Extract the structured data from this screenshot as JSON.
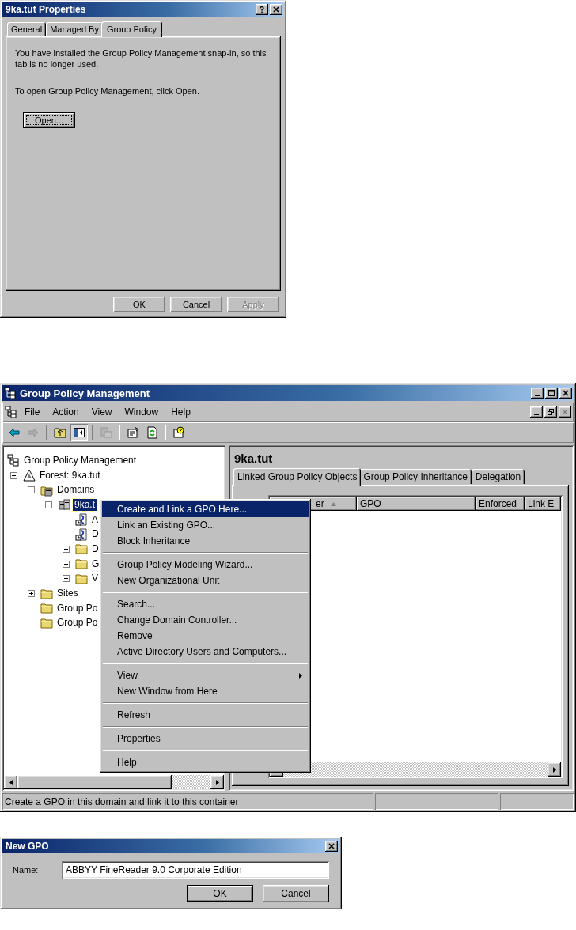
{
  "properties_dialog": {
    "title": "9ka.tut Properties",
    "tabs": [
      {
        "label": "General",
        "selected": false
      },
      {
        "label": "Managed By",
        "selected": false
      },
      {
        "label": "Group Policy",
        "selected": true
      }
    ],
    "paragraphs": [
      "You have installed the Group Policy Management snap-in, so this tab is no longer used.",
      "To open Group Policy Management, click Open."
    ],
    "open_button": {
      "label": "Open...",
      "focused": true
    },
    "buttons": [
      {
        "label": "OK",
        "disabled": false
      },
      {
        "label": "Cancel",
        "disabled": false
      },
      {
        "label": "Apply",
        "disabled": true
      }
    ]
  },
  "gpmc_window": {
    "title": "Group Policy Management",
    "menu_bar": [
      "File",
      "Action",
      "View",
      "Window",
      "Help"
    ],
    "toolbar": [
      {
        "kind": "back",
        "disabled": false,
        "pressed": false
      },
      {
        "kind": "forward",
        "disabled": true,
        "pressed": false
      },
      {
        "kind": "up",
        "disabled": false,
        "pressed": false
      },
      {
        "kind": "tree",
        "disabled": false,
        "pressed": true
      },
      {
        "kind": "export",
        "disabled": true,
        "pressed": false
      },
      {
        "kind": "properties",
        "disabled": false,
        "pressed": false
      },
      {
        "kind": "refresh",
        "disabled": false,
        "pressed": false
      },
      {
        "kind": "help",
        "disabled": false,
        "pressed": false
      }
    ],
    "tree": [
      {
        "label": "Group Policy Management",
        "kind": "console",
        "selected": false,
        "children": [
          {
            "label": "Forest: 9ka.tut",
            "kind": "forest",
            "selected": false,
            "expanded": true,
            "children": [
              {
                "label": "Domains",
                "kind": "domains",
                "selected": false,
                "expanded": true,
                "children": [
                  {
                    "label": "9ka.t",
                    "kind": "domain",
                    "selected": true,
                    "expanded": true,
                    "children": [
                      {
                        "label": "A",
                        "kind": "link",
                        "selected": false
                      },
                      {
                        "label": "D",
                        "kind": "link",
                        "selected": false
                      },
                      {
                        "label": "D",
                        "kind": "folder",
                        "selected": false,
                        "expanded": false
                      },
                      {
                        "label": "G",
                        "kind": "folder",
                        "selected": false,
                        "expanded": false
                      },
                      {
                        "label": "V",
                        "kind": "folder",
                        "selected": false,
                        "expanded": false
                      }
                    ]
                  }
                ]
              },
              {
                "label": "Sites",
                "kind": "folder",
                "selected": false,
                "expanded": false
              },
              {
                "label": "Group Po",
                "kind": "folder",
                "selected": false
              },
              {
                "label": "Group Po",
                "kind": "folder",
                "selected": false
              }
            ]
          }
        ]
      }
    ],
    "details": {
      "title": "9ka.tut",
      "tabs": [
        {
          "label": "Linked Group Policy Objects",
          "selected": true
        },
        {
          "label": "Group Policy Inheritance",
          "selected": false
        },
        {
          "label": "Delegation",
          "selected": false
        }
      ],
      "columns": [
        {
          "label": "er",
          "sorted": true
        },
        {
          "label": "GPO",
          "sorted": false
        },
        {
          "label": "Enforced",
          "sorted": false
        },
        {
          "label": "Link E",
          "sorted": false
        }
      ]
    },
    "context_menu": {
      "groups": [
        [
          {
            "label": "Create and Link a GPO Here...",
            "selected": true,
            "submenu": false
          },
          {
            "label": "Link an Existing GPO...",
            "selected": false,
            "submenu": false
          },
          {
            "label": "Block Inheritance",
            "selected": false,
            "submenu": false
          }
        ],
        [
          {
            "label": "Group Policy Modeling Wizard...",
            "selected": false,
            "submenu": false
          },
          {
            "label": "New Organizational Unit",
            "selected": false,
            "submenu": false
          }
        ],
        [
          {
            "label": "Search...",
            "selected": false,
            "submenu": false
          },
          {
            "label": "Change Domain Controller...",
            "selected": false,
            "submenu": false
          },
          {
            "label": "Remove",
            "selected": false,
            "submenu": false
          },
          {
            "label": "Active Directory Users and Computers...",
            "selected": false,
            "submenu": false
          }
        ],
        [
          {
            "label": "View",
            "selected": false,
            "submenu": true
          },
          {
            "label": "New Window from Here",
            "selected": false,
            "submenu": false
          }
        ],
        [
          {
            "label": "Refresh",
            "selected": false,
            "submenu": false
          }
        ],
        [
          {
            "label": "Properties",
            "selected": false,
            "submenu": false
          }
        ],
        [
          {
            "label": "Help",
            "selected": false,
            "submenu": false
          }
        ]
      ]
    },
    "status_bar": "Create a GPO in this domain and link it to this container"
  },
  "new_gpo_dialog": {
    "title": "New GPO",
    "name_label": "Name:",
    "name_value": "ABBYY FineReader 9.0 Corporate Edition",
    "buttons": [
      {
        "label": "OK",
        "default": true
      },
      {
        "label": "Cancel",
        "default": false
      }
    ]
  }
}
